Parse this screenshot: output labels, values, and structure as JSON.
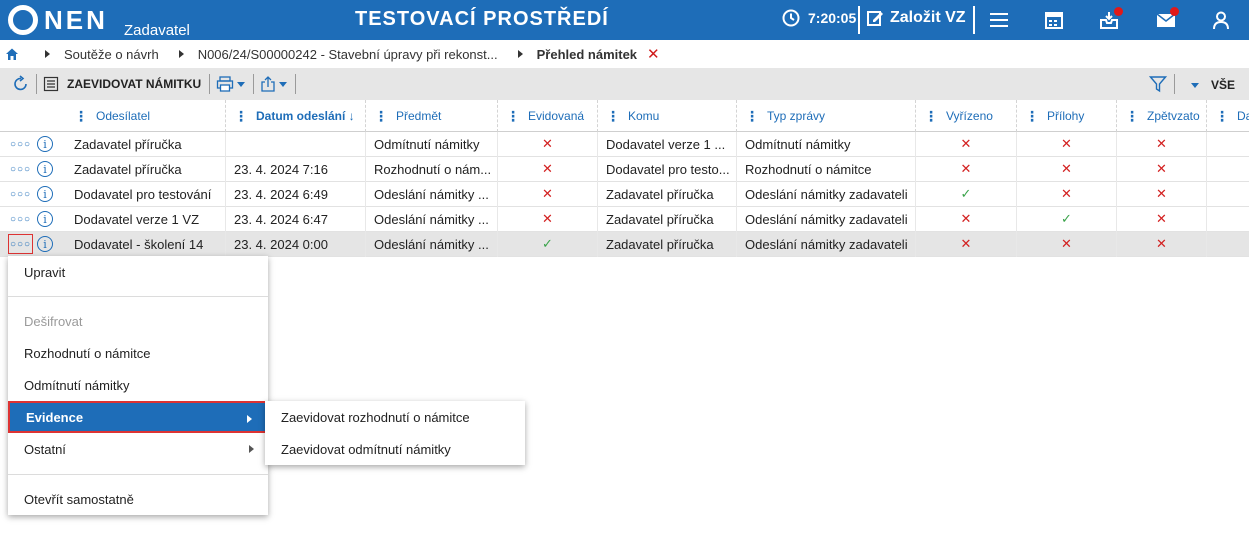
{
  "header": {
    "logo_text": "NEN",
    "logo_sub": "Zadavatel",
    "env_title": "TESTOVACÍ PROSTŘEDÍ",
    "time": "7:20:05",
    "create_vz": "Založit VZ"
  },
  "breadcrumb": {
    "items": [
      "Soutěže o návrh",
      "N006/24/S00000242 - Stavební úpravy při rekonst..."
    ],
    "active": "Přehled námitek"
  },
  "toolbar": {
    "register_label": "ZAEVIDOVAT NÁMITKU",
    "filter_all": "VŠE"
  },
  "table": {
    "columns": [
      "Odesílatel",
      "Datum odeslání ↓",
      "Předmět",
      "Evidovaná",
      "Komu",
      "Typ zprávy",
      "Vyřízeno",
      "Přílohy",
      "Zpětvzato",
      "Datu"
    ],
    "rows": [
      {
        "sender": "Zadavatel příručka",
        "date": "",
        "subject": "Odmítnutí námitky",
        "registered": "x",
        "to": "Dodavatel verze 1 ...",
        "type": "Odmítnutí námitky",
        "resolved": "x",
        "attachments": "x",
        "withdrawn": "x"
      },
      {
        "sender": "Zadavatel příručka",
        "date": "23. 4. 2024 7:16",
        "subject": "Rozhodnutí o nám...",
        "registered": "x",
        "to": "Dodavatel pro testo...",
        "type": "Rozhodnutí o námitce",
        "resolved": "x",
        "attachments": "x",
        "withdrawn": "x"
      },
      {
        "sender": "Dodavatel pro testování",
        "date": "23. 4. 2024 6:49",
        "subject": "Odeslání námitky ...",
        "registered": "x",
        "to": "Zadavatel příručka",
        "type": "Odeslání námitky zadavateli",
        "resolved": "v",
        "attachments": "x",
        "withdrawn": "x"
      },
      {
        "sender": "Dodavatel verze 1 VZ",
        "date": "23. 4. 2024 6:47",
        "subject": "Odeslání námitky ...",
        "registered": "x",
        "to": "Zadavatel příručka",
        "type": "Odeslání námitky zadavateli",
        "resolved": "x",
        "attachments": "v",
        "withdrawn": "x"
      },
      {
        "sender": "Dodavatel - školení 14",
        "date": "23. 4. 2024 0:00",
        "subject": "Odeslání námitky ...",
        "registered": "v",
        "to": "Zadavatel příručka",
        "type": "Odeslání námitky zadavateli",
        "resolved": "x",
        "attachments": "x",
        "withdrawn": "x"
      }
    ]
  },
  "context_menu": {
    "items": [
      "Upravit",
      "Dešifrovat",
      "Rozhodnutí o námitce",
      "Odmítnutí námitky",
      "Evidence",
      "Ostatní",
      "Otevřít samostatně"
    ],
    "submenu": [
      "Zaevidovat rozhodnutí o námitce",
      "Zaevidovat odmítnutí námitky"
    ]
  },
  "colors": {
    "brand": "#1e6db8",
    "error": "#d32020",
    "success": "#3aa34a"
  }
}
